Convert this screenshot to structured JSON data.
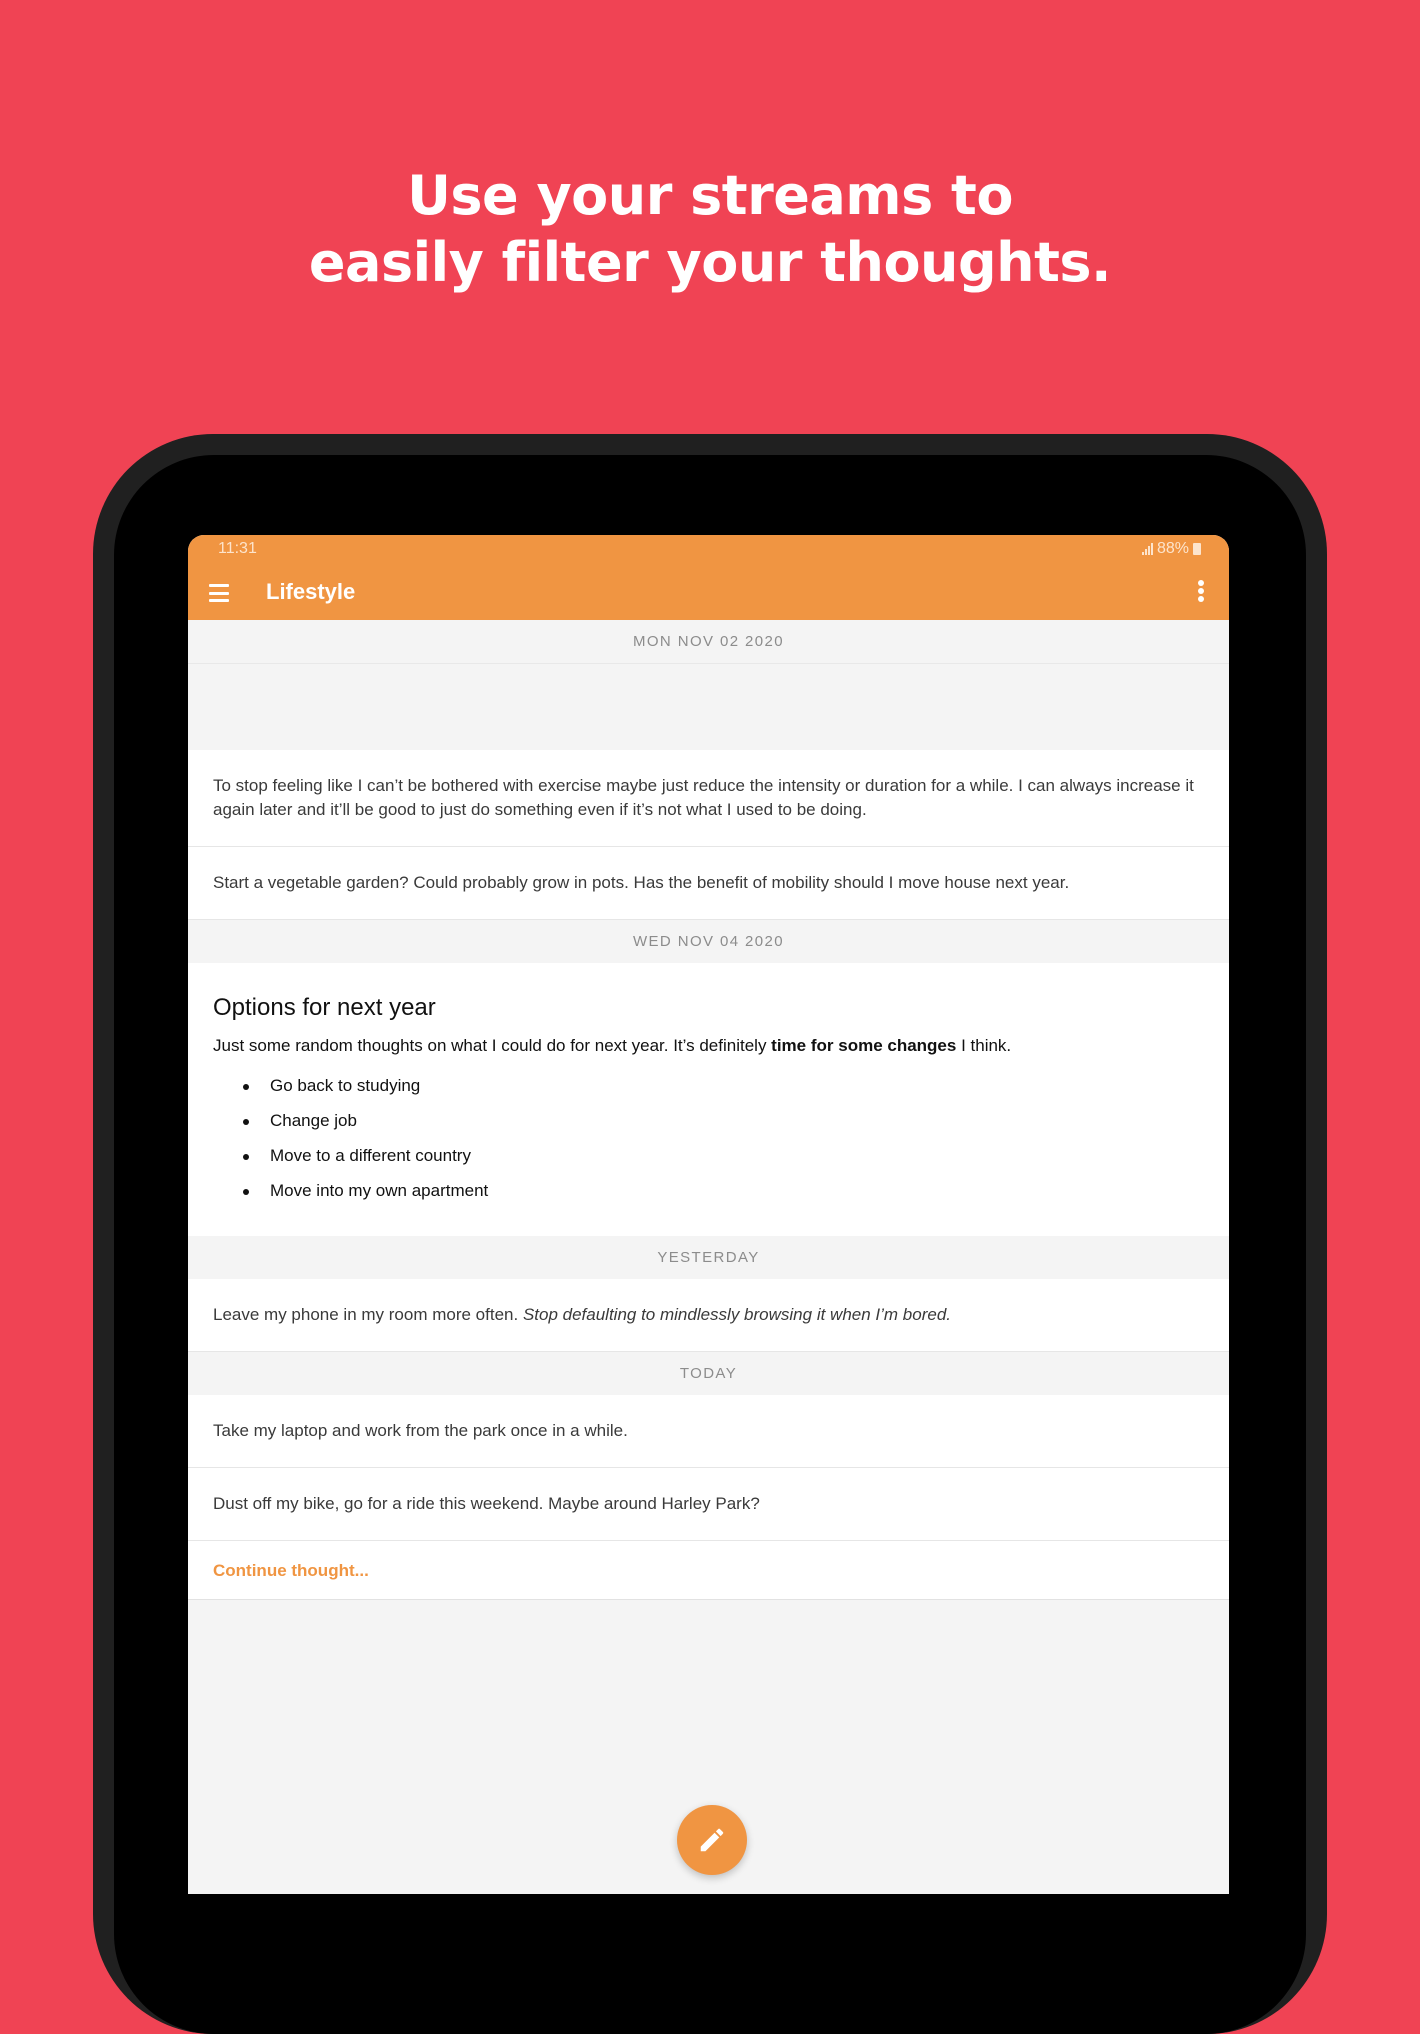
{
  "headline": {
    "line1": "Use your streams to",
    "line2": "easily filter your thoughts."
  },
  "status_bar": {
    "time": "11:31",
    "battery": "88%"
  },
  "app_bar": {
    "title": "Lifestyle",
    "menu_icon": "hamburger-menu-icon",
    "more_icon": "more-vertical-icon"
  },
  "sections": {
    "s1": {
      "date": "MON NOV 02 2020",
      "note1": "To stop feeling like I can’t be bothered with exercise maybe just reduce the intensity or duration for a while. I can always increase it again later and it’ll be good to just do something even if it’s not what I used to be doing.",
      "note2": "Start a vegetable garden? Could probably grow in pots. Has the benefit of mobility should I move house next year."
    },
    "s2": {
      "date": "WED NOV 04 2020",
      "title": "Options for next year",
      "body_prefix": "Just some random thoughts on what I could do for next year. It’s definitely ",
      "body_bold": "time for some changes",
      "body_suffix": " I think.",
      "items": [
        "Go back to studying",
        "Change job",
        "Move to a different country",
        "Move into my own apartment"
      ]
    },
    "s3": {
      "date": "YESTERDAY",
      "note_plain": "Leave my phone in my room more often. ",
      "note_italic": "Stop defaulting to mindlessly browsing it when I’m bored."
    },
    "s4": {
      "date": "TODAY",
      "note1": "Take my laptop and work from the park once in a while.",
      "note2": "Dust off my bike, go for a ride this weekend. Maybe around Harley Park?"
    }
  },
  "continue_label": "Continue thought...",
  "fab_icon": "pencil-icon",
  "colors": {
    "background": "#f04354",
    "accent": "#f09542"
  }
}
